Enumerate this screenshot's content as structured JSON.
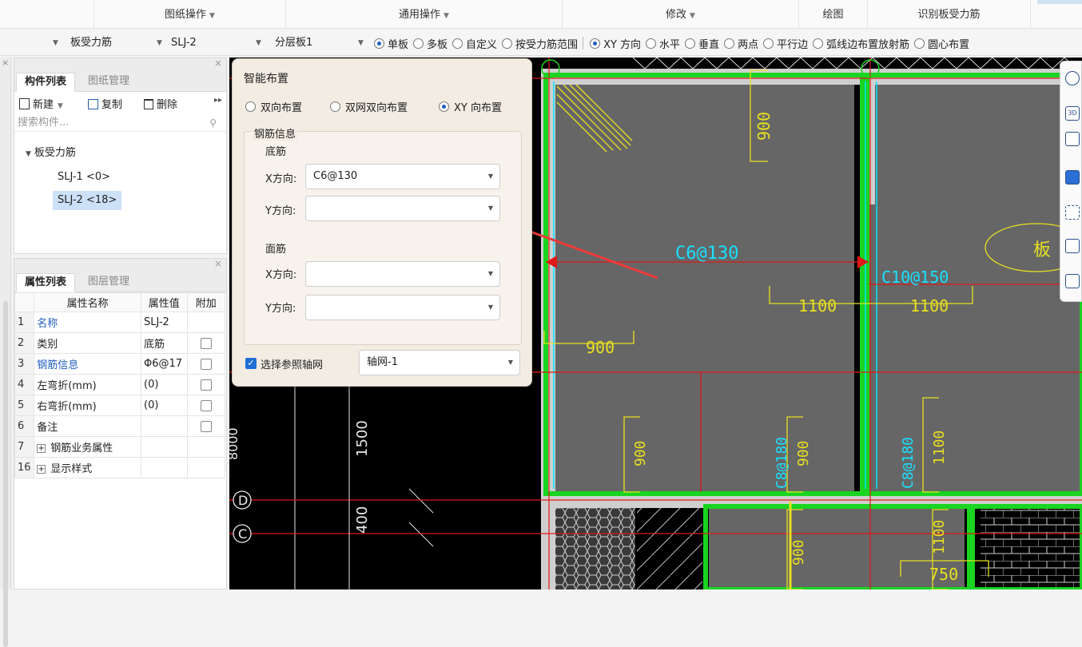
{
  "ribbon": {
    "groups": [
      "图纸操作",
      "通用操作",
      "修改",
      "绘图",
      "识别板受力筋"
    ]
  },
  "toolbar2": {
    "type_value": "板受力筋",
    "name_value": "SLJ-2",
    "layer_value": "分层板1",
    "radios": [
      "单板",
      "多板",
      "自定义",
      "按受力筋范围",
      "XY 方向",
      "水平",
      "垂直",
      "两点",
      "平行边",
      "弧线边布置放射筋",
      "圆心布置"
    ]
  },
  "component_panel": {
    "tabs": [
      "构件列表",
      "图纸管理"
    ],
    "new_label": "新建",
    "copy_label": "复制",
    "delete_label": "删除",
    "search_placeholder": "搜索构件...",
    "tree_root": "板受力筋",
    "items": [
      "SLJ-1 <0>",
      "SLJ-2 <18>"
    ]
  },
  "property_panel": {
    "tabs": [
      "属性列表",
      "图层管理"
    ],
    "headers": [
      "属性名称",
      "属性值",
      "附加"
    ],
    "rows": [
      {
        "num": "1",
        "name": "名称",
        "value": "SLJ-2"
      },
      {
        "num": "2",
        "name": "类别",
        "value": "底筋"
      },
      {
        "num": "3",
        "name": "钢筋信息",
        "value": "Φ6@17"
      },
      {
        "num": "4",
        "name": "左弯折(mm)",
        "value": "(0)"
      },
      {
        "num": "5",
        "name": "右弯折(mm)",
        "value": "(0)"
      },
      {
        "num": "6",
        "name": "备注",
        "value": ""
      },
      {
        "num": "7",
        "name": "钢筋业务属性",
        "value": ""
      },
      {
        "num": "16",
        "name": "显示样式",
        "value": ""
      }
    ]
  },
  "dialog": {
    "title": "智能布置",
    "mode_options": [
      "双向布置",
      "双网双向布置",
      "XY 向布置"
    ],
    "section_label": "钢筋信息",
    "bottom_label": "底筋",
    "top_label": "面筋",
    "x_label": "X方向:",
    "y_label": "Y方向:",
    "bottom_x_value": "C6@130",
    "ref_axis_label": "选择参照轴网",
    "ref_axis_value": "轴网-1"
  },
  "cad": {
    "rebar_label_1": "C6@130",
    "rebar_label_2": "C10@150",
    "rebar_label_3": "C8@180",
    "dims": [
      "900",
      "1100",
      "1100",
      "900",
      "900",
      "900",
      "1100",
      "1100",
      "750",
      "1500",
      "400",
      "8000",
      "900"
    ],
    "axis_labels": [
      "D",
      "C"
    ],
    "partial_label": "板"
  }
}
